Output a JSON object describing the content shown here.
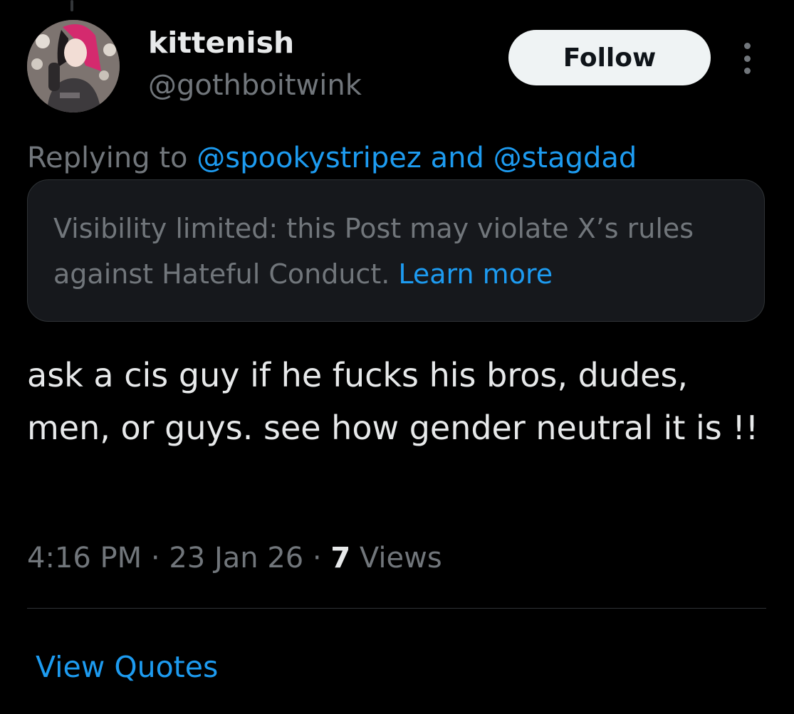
{
  "author": {
    "display_name": "kittenish",
    "handle": "@gothboitwink",
    "avatar_icon": "profile-avatar"
  },
  "follow_button": {
    "label": "Follow"
  },
  "more_menu": {
    "icon": "more-vertical-icon"
  },
  "reply_context": {
    "prefix": "Replying to ",
    "mention_1": "@spookystripez",
    "joiner": " and ",
    "mention_2": "@stagdad"
  },
  "visibility_notice": {
    "text": "Visibility limited: this Post may violate X’s rules against Hateful Conduct.",
    "link": "Learn more"
  },
  "post": {
    "text": "ask a cis guy if he fucks his bros, dudes, men, or guys. see how gender neutral it is !!"
  },
  "meta": {
    "time": "4:16 PM",
    "separator": " · ",
    "date": "23 Jan 26",
    "views_count": "7",
    "views_label": " Views"
  },
  "footer": {
    "view_quotes": "View Quotes"
  },
  "colors": {
    "background": "#000000",
    "primary_text": "#e7e9ea",
    "secondary_text": "#71767b",
    "accent": "#1d9bf0",
    "notice_bg": "#16181c",
    "divider": "#2f3336"
  }
}
